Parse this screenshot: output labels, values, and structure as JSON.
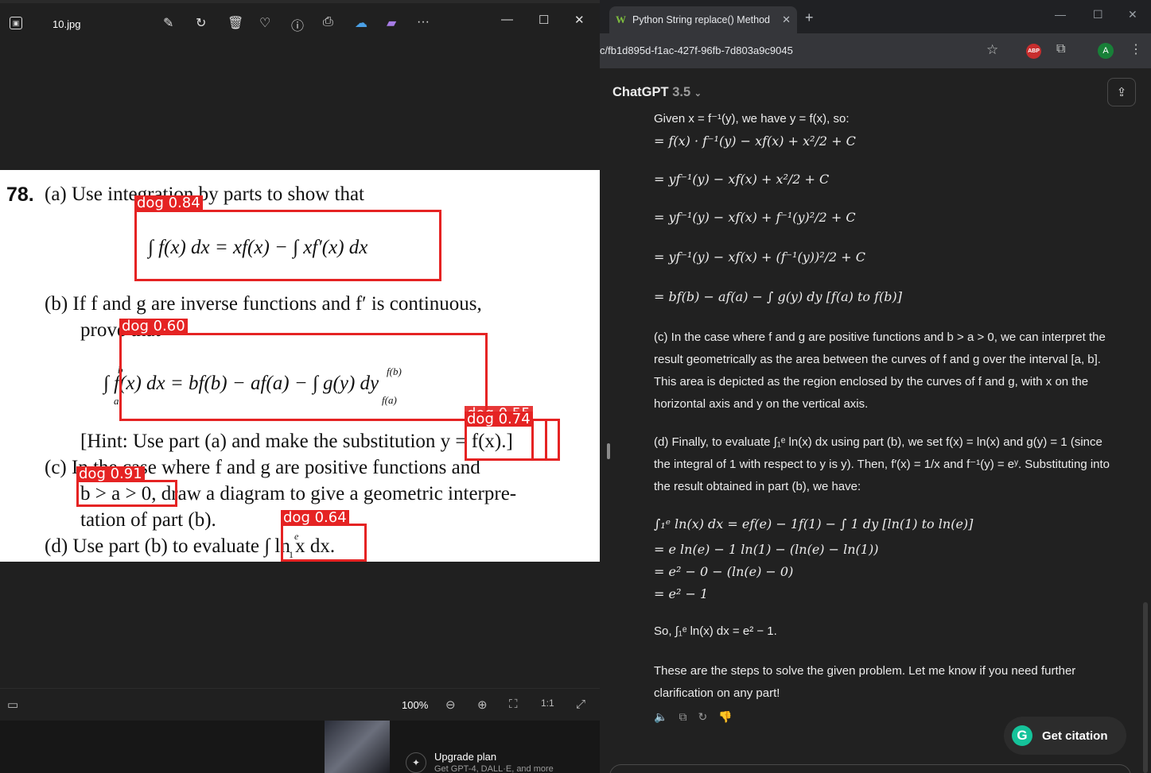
{
  "viewer": {
    "file_name": "10.jpg",
    "zoom": "100%",
    "photo": {
      "problem_number": "78.",
      "line_a": "(a)  Use integration by parts to show that",
      "eq_a": "∫ f(x) dx = xf(x) − ∫ xf′(x) dx",
      "line_b1": "(b)  If f and g are inverse functions and f′ is continuous,",
      "line_b2": "prove that",
      "eq_b": "∫ f(x) dx = bf(b) − af(a) − ∫ g(y) dy",
      "eq_b_lower": "a",
      "eq_b_upper": "b",
      "eq_b_int_lower": "f(a)",
      "eq_b_int_upper": "f(b)",
      "hint": "[Hint: Use part (a) and make the substitution y = f(x).]",
      "line_c1": "(c)  In the case where f and g are positive functions and",
      "line_c2": "b > a > 0, draw a diagram to give a geometric interpre-",
      "line_c3": "tation of part (b).",
      "line_d": "(d)  Use part (b) to evaluate ∫ ln x dx.",
      "line_d_upper": "e",
      "line_d_lower": "1",
      "detections": [
        {
          "label": "dog 0.84"
        },
        {
          "label": "dog 0.60"
        },
        {
          "label": "dog 0.74"
        },
        {
          "label": "dog 0.55"
        },
        {
          "label": "dog 0.91"
        },
        {
          "label": "dog 0.64"
        }
      ]
    }
  },
  "below_strip": {
    "upgrade_title": "Upgrade plan",
    "upgrade_subtitle": "Get GPT-4, DALL·E, and more"
  },
  "browser": {
    "tab_title": "Python String replace() Method",
    "url": "c/fb1d895d-f1ac-427f-96fb-7d803a9c9045",
    "profile_initial": "A",
    "abp_label": "ABP"
  },
  "chat": {
    "model_name": "ChatGPT",
    "model_version": "3.5",
    "given_line": "Given x = f⁻¹(y), we have y = f(x), so:",
    "steps": [
      "= f(x) · f⁻¹(y) − xf(x) + x²/2 + C",
      "= yf⁻¹(y) − xf(x) + x²/2 + C",
      "= yf⁻¹(y) − xf(x) + f⁻¹(y)²/2 + C",
      "= yf⁻¹(y) − xf(x) + (f⁻¹(y))²/2 + C",
      "= bf(b) − af(a) − ∫ g(y) dy  [f(a) to f(b)]"
    ],
    "part_c": "(c) In the case where f and g are positive functions and b > a > 0, we can interpret the result geometrically as the area between the curves of f and g over the interval [a, b]. This area is depicted as the region enclosed by the curves of f and g, with x on the horizontal axis and y on the vertical axis.",
    "part_d": "(d) Finally, to evaluate ∫₁ᵉ ln(x) dx using part (b), we set f(x) = ln(x) and g(y) = 1 (since the integral of 1 with respect to y is y). Then, f′(x) = 1/x and f⁻¹(y) = eʸ. Substituting into the result obtained in part (b), we have:",
    "eval_lines": [
      "∫₁ᵉ ln(x) dx = ef(e) − 1f(1) − ∫ 1 dy  [ln(1) to ln(e)]",
      "= e ln(e) − 1 ln(1) − (ln(e) − ln(1))",
      "= e² − 0 − (ln(e) − 0)",
      "= e² − 1"
    ],
    "conclusion": "So, ∫₁ᵉ ln(x) dx = e² − 1.",
    "closing": "These are the steps to solve the given problem. Let me know if you need further clarification on any part!",
    "citation_button": "Get citation"
  }
}
